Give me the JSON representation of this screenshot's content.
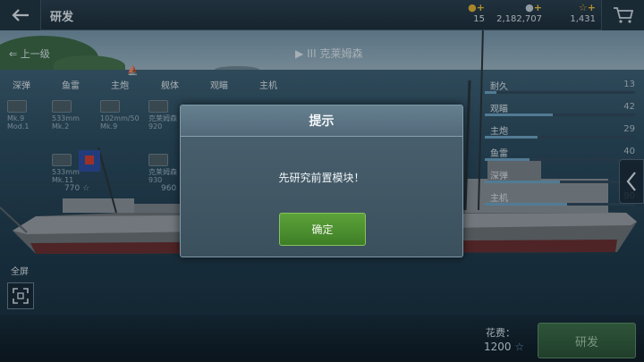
{
  "header": {
    "title": "研发",
    "back_icon": "back-arrow-icon"
  },
  "resources": [
    {
      "name": "gold-coin-icon",
      "value": "15"
    },
    {
      "name": "silver-coin-icon",
      "value": "2,182,707"
    },
    {
      "name": "star-icon",
      "value": "1,431"
    }
  ],
  "shop_icon": "cart-icon",
  "nav": {
    "up_label": "上一级",
    "ship_name": "克莱姆森",
    "tier": "III"
  },
  "categories": [
    "深弹",
    "鱼雷",
    "主炮",
    "舰体",
    "观瞄",
    "主机"
  ],
  "modules": [
    {
      "label": "Mk.9 Mod.1"
    },
    {
      "label": "533mm Mk.2"
    },
    {
      "label": "102mm/50 Mk.9"
    },
    {
      "label": "克莱姆森 920"
    },
    {
      "label": "533mm Mk.11"
    },
    {
      "label": "克莱姆森 930"
    }
  ],
  "module_costs": [
    "770",
    "960"
  ],
  "stats": [
    {
      "label": "耐久",
      "value": "13",
      "fraction": 0.08
    },
    {
      "label": "观瞄",
      "value": "42",
      "fraction": 0.45
    },
    {
      "label": "主炮",
      "value": "29",
      "fraction": 0.35
    },
    {
      "label": "鱼雷",
      "value": "40",
      "fraction": 0.3
    },
    {
      "label": "深弹",
      "value": "",
      "fraction": 0.5
    },
    {
      "label": "主机",
      "value": "90",
      "fraction": 0.55
    }
  ],
  "fullscreen_label": "全屏",
  "cost": {
    "label": "花费：",
    "value": "1200"
  },
  "research_button": "研发",
  "dialog": {
    "title": "提示",
    "message": "先研究前置模块！",
    "ok": "确定"
  },
  "colors": {
    "accent_green": "#4f9432",
    "stat_bar": "#6fa5c5",
    "gold": "#f0c43a"
  }
}
